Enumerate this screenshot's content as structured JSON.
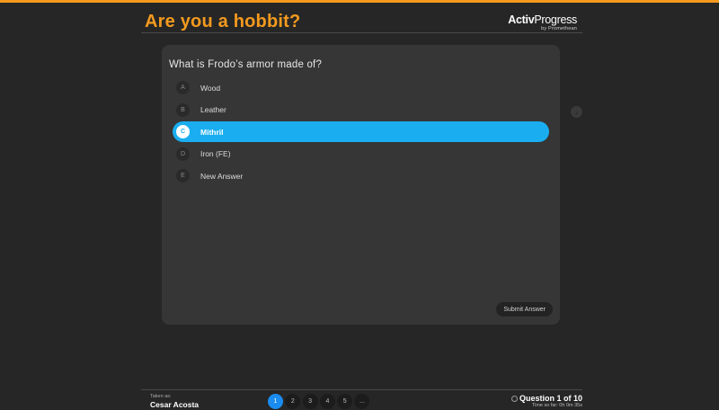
{
  "colors": {
    "accent": "#f39a1e",
    "selected": "#1aaef0",
    "active_page": "#1a8cf0"
  },
  "header": {
    "title": "Are you a hobbit?",
    "brand_bold": "Activ",
    "brand_rest": "Progress",
    "brand_sub": "by Promethean"
  },
  "question": {
    "text": "What is Frodo’s armor made of?",
    "answers": [
      {
        "letter": "A",
        "label": "Wood",
        "selected": false
      },
      {
        "letter": "B",
        "label": "Leather",
        "selected": false
      },
      {
        "letter": "C",
        "label": "Mithril",
        "selected": true
      },
      {
        "letter": "D",
        "label": "Iron (FE)",
        "selected": false
      },
      {
        "letter": "E",
        "label": "New Answer",
        "selected": false
      }
    ],
    "submit_label": "Submit Answer"
  },
  "nav": {
    "next_icon": "chevron-right-icon",
    "next_glyph": "›"
  },
  "footer": {
    "taken_as_label": "Taken as:",
    "user_name": "Cesar Acosta",
    "pages": [
      "1",
      "2",
      "3",
      "4",
      "5",
      "..."
    ],
    "active_page": "1",
    "question_count": "Question 1 of 10",
    "time_so_far": "Time so far: 0h 0m 35s"
  }
}
